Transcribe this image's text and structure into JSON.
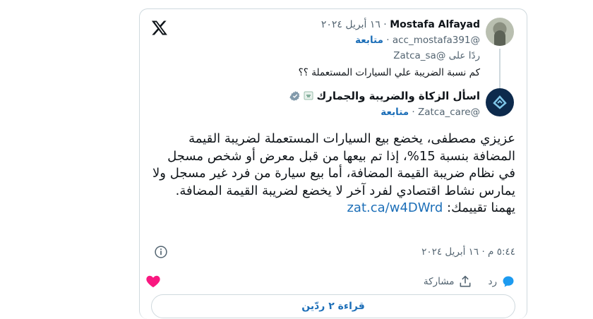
{
  "original_tweet": {
    "author_name": "Mostafa Alfayad",
    "date": "١٦ أبريل ٢٠٢٤",
    "handle": "@acc_mostafa391",
    "follow_label": "متابعة",
    "replying_to_prefix": "ردًا على",
    "replying_to_handle": "@Zatca_sa",
    "text": "كم نسبة الضريبة علي السيارات المستعملة ؟؟"
  },
  "reply_tweet": {
    "author_name": "اسأل الزكاة والضريبة والجمارك",
    "handle": "@Zatca_care",
    "follow_label": "متابعة",
    "text": "عزيزي مصطفى، يخضع بيع السيارات المستعملة لضريبة القيمة المضافة بنسبة 15%، إذا تم بيعها من قبل معرض أو شخص مسجل في نظام ضريبة القيمة المضافة، أما بيع سيارة من فرد غير مسجل ولا يمارس نشاط اقتصادي لفرد آخر لا يخضع لضريبة القيمة المضافة.",
    "rating_prefix": "يهمنا تقييمك:",
    "link": "zat.ca/w4DWrd",
    "timestamp": "٥:٤٤ م · ١٦ أبريل ٢٠٢٤"
  },
  "actions": {
    "reply_label": "رد",
    "share_label": "مشاركة"
  },
  "read_replies_label": "قراءة ٢ ردّين",
  "colors": {
    "accent": "#1d6fb8",
    "secondary_text": "#536471",
    "border": "#cfd9de",
    "heart": "#f91880"
  },
  "icons": [
    "x-logo-icon",
    "verified-badge-icon",
    "info-icon",
    "reply-icon",
    "share-icon",
    "heart-icon",
    "flag-icon"
  ]
}
